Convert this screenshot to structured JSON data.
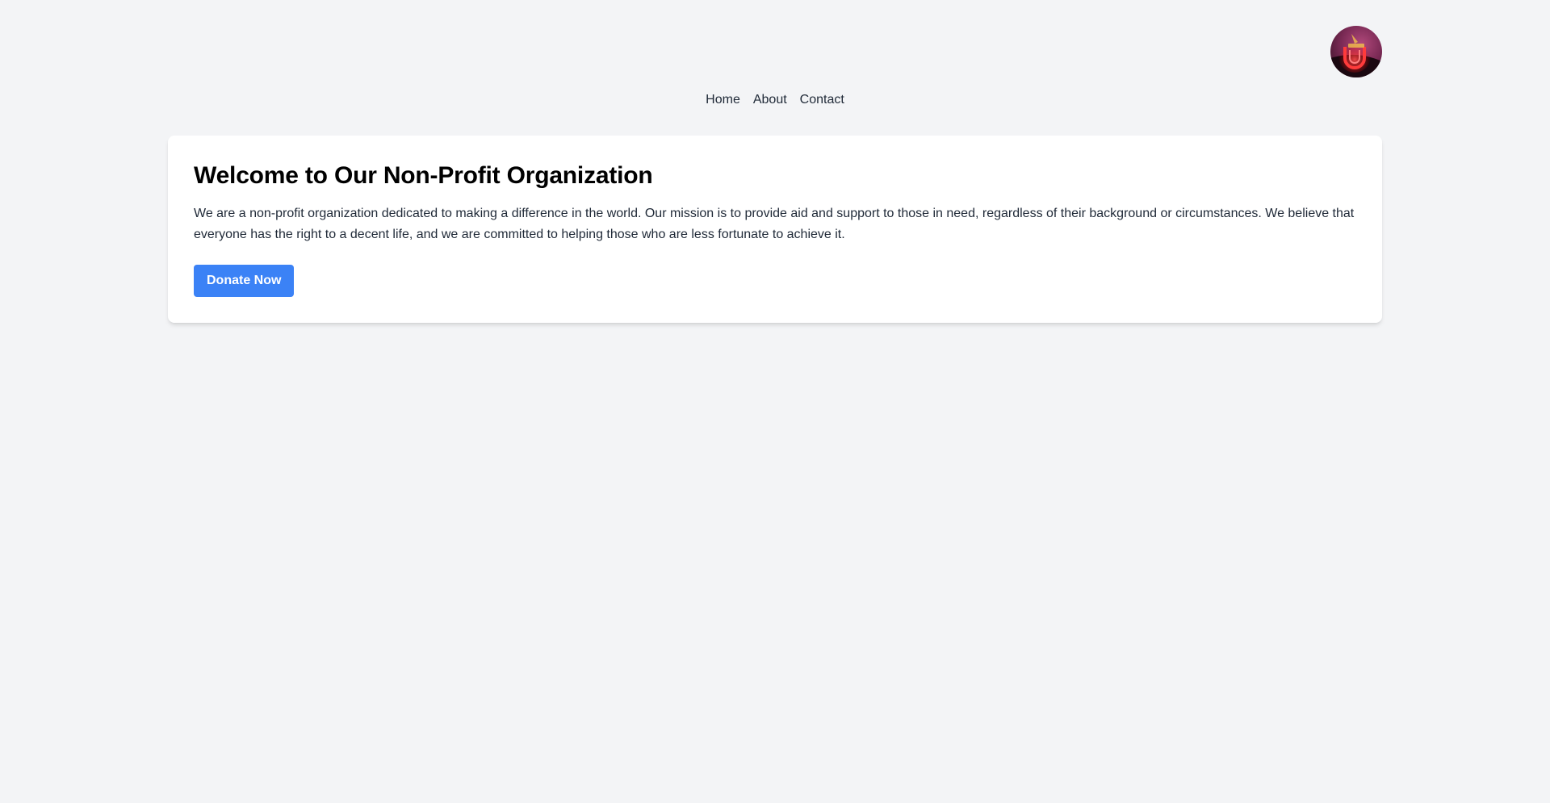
{
  "header": {
    "avatar_icon": "user-avatar"
  },
  "nav": {
    "items": [
      {
        "label": "Home"
      },
      {
        "label": "About"
      },
      {
        "label": "Contact"
      }
    ]
  },
  "main": {
    "title": "Welcome to Our Non-Profit Organization",
    "description": "We are a non-profit organization dedicated to making a difference in the world. Our mission is to provide aid and support to those in need, regardless of their background or circumstances. We believe that everyone has the right to a decent life, and we are committed to helping those who are less fortunate to achieve it.",
    "donate_label": "Donate Now"
  },
  "colors": {
    "background": "#f3f4f6",
    "card": "#ffffff",
    "accent": "#3b82f6",
    "text": "#1f2937"
  }
}
